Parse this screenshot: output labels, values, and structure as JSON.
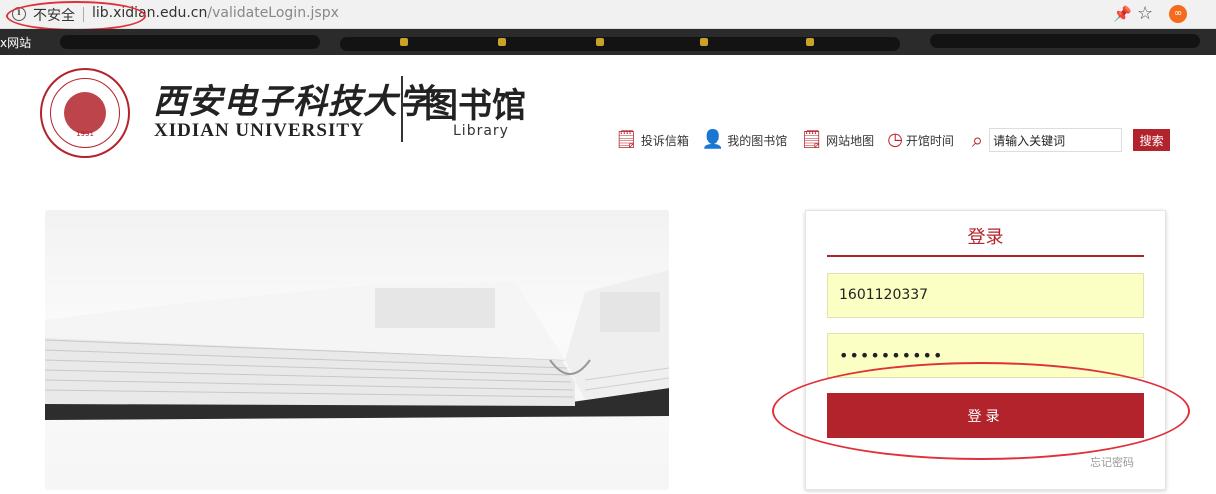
{
  "browser": {
    "security_label": "不安全",
    "url_host": "lib.xidian.edu.cn",
    "url_path": "/validateLogin.jspx",
    "bookmark_label": "x网站",
    "info_icon": "info-icon",
    "pin_icon": "pin-icon",
    "star_icon": "bookmark-star-icon",
    "extension_icon": "extension-icon"
  },
  "header": {
    "university_cn": "西安电子科技大学",
    "university_en": "XIDIAN UNIVERSITY",
    "library_cn": "图书馆",
    "library_en": "Library",
    "seal_year": "1931"
  },
  "nav": {
    "items": [
      {
        "label": "投诉信箱",
        "icon": "document-icon"
      },
      {
        "label": "我的图书馆",
        "icon": "user-icon"
      },
      {
        "label": "网站地图",
        "icon": "sitemap-icon"
      },
      {
        "label": "开馆时间",
        "icon": "clock-icon"
      }
    ],
    "search_placeholder": "请输入关键词",
    "search_button": "搜索"
  },
  "login": {
    "title": "登录",
    "username_value": "1601120337",
    "password_value": "••••••••••",
    "submit_label": "登录",
    "forgot_label": "忘记密码"
  },
  "colors": {
    "brand_red": "#b2232b",
    "field_bg": "#fbffc4",
    "annotation_red": "#e0303a"
  }
}
